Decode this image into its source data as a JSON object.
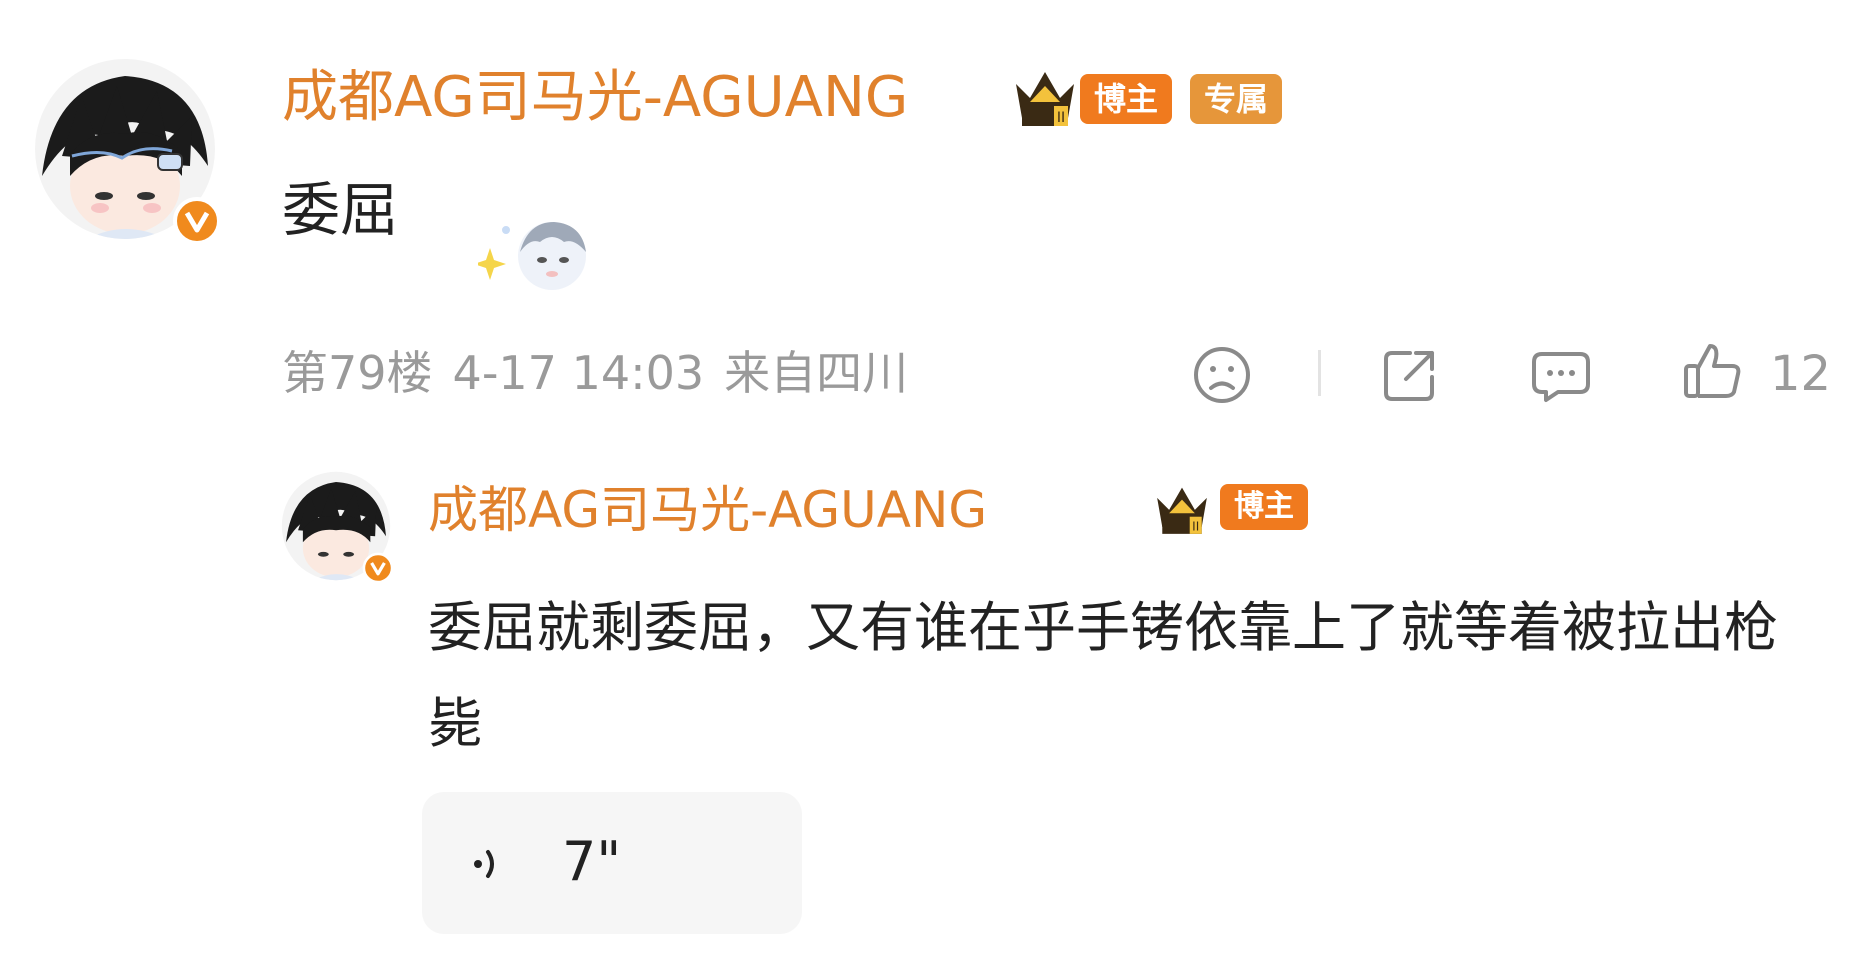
{
  "comment": {
    "username": "成都AG司马光-AGUANG",
    "badges": {
      "blogger": "博主",
      "exclusive": "专属"
    },
    "text": "委屈",
    "meta": {
      "floor": "第79楼",
      "date": "4-17 14:03",
      "location": "来自四川"
    },
    "actions": {
      "like_count": "12",
      "icons": [
        "sad-face-icon",
        "share-icon",
        "comment-icon",
        "like-icon"
      ]
    }
  },
  "reply": {
    "username": "成都AG司马光-AGUANG",
    "badges": {
      "blogger": "博主"
    },
    "text": "委屈就剩委屈，又有谁在乎手铐依靠上了就等着被拉出枪毙",
    "voice": {
      "duration": "7\""
    }
  },
  "colors": {
    "username": "#e0812c",
    "badge_blogger": "#f07a1e",
    "badge_exclusive": "#e6963a",
    "meta_text": "#9a9a9a",
    "verified": "#f08a1d"
  }
}
